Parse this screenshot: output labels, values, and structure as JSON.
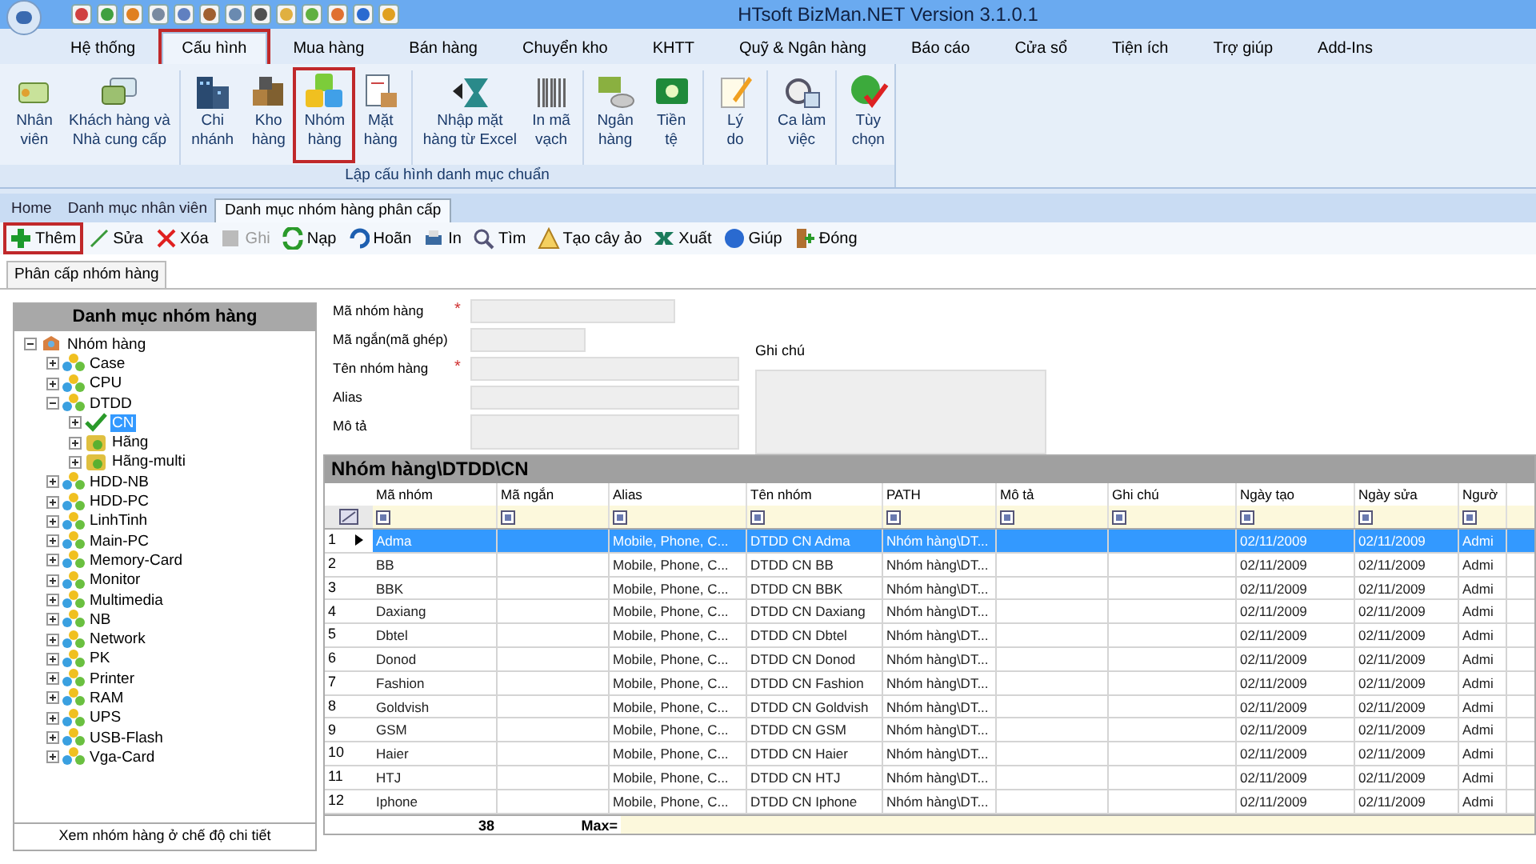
{
  "window": {
    "title": "HTsoft BizMan.NET Version 3.1.0.1"
  },
  "menu_tabs": [
    {
      "label": "Hệ thống",
      "selected": false,
      "highlighted": false
    },
    {
      "label": "Cấu hình",
      "selected": true,
      "highlighted": true
    },
    {
      "label": "Mua hàng",
      "selected": false,
      "highlighted": false
    },
    {
      "label": "Bán hàng",
      "selected": false,
      "highlighted": false
    },
    {
      "label": "Chuyển kho",
      "selected": false,
      "highlighted": false
    },
    {
      "label": "KHTT",
      "selected": false,
      "highlighted": false
    },
    {
      "label": "Quỹ & Ngân hàng",
      "selected": false,
      "highlighted": false
    },
    {
      "label": "Báo cáo",
      "selected": false,
      "highlighted": false
    },
    {
      "label": "Cửa sổ",
      "selected": false,
      "highlighted": false
    },
    {
      "label": "Tiện ích",
      "selected": false,
      "highlighted": false
    },
    {
      "label": "Trợ giúp",
      "selected": false,
      "highlighted": false
    },
    {
      "label": "Add-Ins",
      "selected": false,
      "highlighted": false
    }
  ],
  "ribbon": {
    "group_label": "Lập cấu hình danh mục chuẩn",
    "sections": [
      [
        {
          "lines": [
            "Nhân",
            "viên"
          ],
          "highlighted": false
        },
        {
          "lines": [
            "Khách hàng và",
            "Nhà cung cấp"
          ],
          "highlighted": false
        }
      ],
      [
        {
          "lines": [
            "Chi",
            "nhánh"
          ],
          "highlighted": false
        },
        {
          "lines": [
            "Kho",
            "hàng"
          ],
          "highlighted": false
        },
        {
          "lines": [
            "Nhóm",
            "hàng"
          ],
          "highlighted": true
        },
        {
          "lines": [
            "Mặt",
            "hàng"
          ],
          "highlighted": false
        }
      ],
      [
        {
          "lines": [
            "Nhập mặt",
            "hàng từ Excel"
          ],
          "highlighted": false
        },
        {
          "lines": [
            "In mã",
            "vạch"
          ],
          "highlighted": false
        }
      ],
      [
        {
          "lines": [
            "Ngân",
            "hàng"
          ],
          "highlighted": false
        },
        {
          "lines": [
            "Tiền",
            "tệ"
          ],
          "highlighted": false
        }
      ],
      [
        {
          "lines": [
            "Lý",
            "do"
          ],
          "highlighted": false
        }
      ],
      [
        {
          "lines": [
            "Ca làm",
            "việc"
          ],
          "highlighted": false
        }
      ],
      [
        {
          "lines": [
            "Tùy",
            "chọn"
          ],
          "highlighted": false
        }
      ]
    ]
  },
  "doc_tabs": [
    {
      "label": "Home",
      "selected": false
    },
    {
      "label": "Danh mục nhân viên",
      "selected": false
    },
    {
      "label": "Danh mục nhóm hàng phân cấp",
      "selected": true
    }
  ],
  "toolbar": [
    {
      "label": "Thêm",
      "disabled": false,
      "highlighted": true
    },
    {
      "label": "Sửa",
      "disabled": false,
      "highlighted": false
    },
    {
      "label": "Xóa",
      "disabled": false,
      "highlighted": false
    },
    {
      "label": "Ghi",
      "disabled": true,
      "highlighted": false
    },
    {
      "label": "Nạp",
      "disabled": false,
      "highlighted": false
    },
    {
      "label": "Hoãn",
      "disabled": false,
      "highlighted": false
    },
    {
      "label": "In",
      "disabled": false,
      "highlighted": false
    },
    {
      "label": "Tìm",
      "disabled": false,
      "highlighted": false
    },
    {
      "label": "Tạo cây ảo",
      "disabled": false,
      "highlighted": false
    },
    {
      "label": "Xuất",
      "disabled": false,
      "highlighted": false
    },
    {
      "label": "Giúp",
      "disabled": false,
      "highlighted": false
    },
    {
      "label": "Đóng",
      "disabled": false,
      "highlighted": false
    }
  ],
  "sub_tabs": [
    {
      "label": "Phân cấp nhóm hàng",
      "selected": true
    }
  ],
  "tree_panel": {
    "title": "Danh mục nhóm hàng",
    "footer": "Xem nhóm hàng ở chế độ chi tiết",
    "tree": [
      {
        "label": "Nhóm hàng",
        "kind": "root",
        "expanded": true,
        "selected": false,
        "children": [
          {
            "label": "Case",
            "kind": "group",
            "expanded": false,
            "selected": false
          },
          {
            "label": "CPU",
            "kind": "group",
            "expanded": false,
            "selected": false
          },
          {
            "label": "DTDD",
            "kind": "group",
            "expanded": true,
            "selected": false,
            "children": [
              {
                "label": "CN",
                "kind": "check",
                "expanded": false,
                "selected": true
              },
              {
                "label": "Hãng",
                "kind": "brand",
                "expanded": false,
                "selected": false
              },
              {
                "label": "Hãng-multi",
                "kind": "brand",
                "expanded": false,
                "selected": false
              }
            ]
          },
          {
            "label": "HDD-NB",
            "kind": "group",
            "expanded": false,
            "selected": false
          },
          {
            "label": "HDD-PC",
            "kind": "group",
            "expanded": false,
            "selected": false
          },
          {
            "label": "LinhTinh",
            "kind": "group",
            "expanded": false,
            "selected": false
          },
          {
            "label": "Main-PC",
            "kind": "group",
            "expanded": false,
            "selected": false
          },
          {
            "label": "Memory-Card",
            "kind": "group",
            "expanded": false,
            "selected": false
          },
          {
            "label": "Monitor",
            "kind": "group",
            "expanded": false,
            "selected": false
          },
          {
            "label": "Multimedia",
            "kind": "group",
            "expanded": false,
            "selected": false
          },
          {
            "label": "NB",
            "kind": "group",
            "expanded": false,
            "selected": false
          },
          {
            "label": "Network",
            "kind": "group",
            "expanded": false,
            "selected": false
          },
          {
            "label": "PK",
            "kind": "group",
            "expanded": false,
            "selected": false
          },
          {
            "label": "Printer",
            "kind": "group",
            "expanded": false,
            "selected": false
          },
          {
            "label": "RAM",
            "kind": "group",
            "expanded": false,
            "selected": false
          },
          {
            "label": "UPS",
            "kind": "group",
            "expanded": false,
            "selected": false
          },
          {
            "label": "USB-Flash",
            "kind": "group",
            "expanded": false,
            "selected": false
          },
          {
            "label": "Vga-Card",
            "kind": "group",
            "expanded": false,
            "selected": false
          }
        ]
      }
    ]
  },
  "form": {
    "fields": [
      {
        "label": "Mã nhóm hàng",
        "required": true
      },
      {
        "label": "Mã ngắn(mã ghép)",
        "required": false
      },
      {
        "label": "Tên nhóm hàng",
        "required": true
      },
      {
        "label": "Alias",
        "required": false
      },
      {
        "label": "Mô tả",
        "required": false
      }
    ],
    "required_mark": "*",
    "note_label": "Ghi chú"
  },
  "grid": {
    "title": "Nhóm hàng\\DTDD\\CN",
    "columns": [
      "Mã nhóm",
      "Mã ngắn",
      "Alias",
      "Tên nhóm",
      "PATH",
      "Mô tả",
      "Ghi chú",
      "Ngày tạo",
      "Ngày sửa",
      "Ngườ"
    ],
    "rows": [
      {
        "number": "1",
        "selected": true,
        "cells": [
          "Adma",
          "",
          "Mobile, Phone, C...",
          "DTDD CN Adma",
          "Nhóm hàng\\DT...",
          "",
          "",
          "02/11/2009",
          "02/11/2009",
          "Admi"
        ]
      },
      {
        "number": "2",
        "selected": false,
        "cells": [
          "BB",
          "",
          "Mobile, Phone, C...",
          "DTDD CN BB",
          "Nhóm hàng\\DT...",
          "",
          "",
          "02/11/2009",
          "02/11/2009",
          "Admi"
        ]
      },
      {
        "number": "3",
        "selected": false,
        "cells": [
          "BBK",
          "",
          "Mobile, Phone, C...",
          "DTDD CN BBK",
          "Nhóm hàng\\DT...",
          "",
          "",
          "02/11/2009",
          "02/11/2009",
          "Admi"
        ]
      },
      {
        "number": "4",
        "selected": false,
        "cells": [
          "Daxiang",
          "",
          "Mobile, Phone, C...",
          "DTDD CN Daxiang",
          "Nhóm hàng\\DT...",
          "",
          "",
          "02/11/2009",
          "02/11/2009",
          "Admi"
        ]
      },
      {
        "number": "5",
        "selected": false,
        "cells": [
          "Dbtel",
          "",
          "Mobile, Phone, C...",
          "DTDD CN Dbtel",
          "Nhóm hàng\\DT...",
          "",
          "",
          "02/11/2009",
          "02/11/2009",
          "Admi"
        ]
      },
      {
        "number": "6",
        "selected": false,
        "cells": [
          "Donod",
          "",
          "Mobile, Phone, C...",
          "DTDD CN Donod",
          "Nhóm hàng\\DT...",
          "",
          "",
          "02/11/2009",
          "02/11/2009",
          "Admi"
        ]
      },
      {
        "number": "7",
        "selected": false,
        "cells": [
          "Fashion",
          "",
          "Mobile, Phone, C...",
          "DTDD CN Fashion",
          "Nhóm hàng\\DT...",
          "",
          "",
          "02/11/2009",
          "02/11/2009",
          "Admi"
        ]
      },
      {
        "number": "8",
        "selected": false,
        "cells": [
          "Goldvish",
          "",
          "Mobile, Phone, C...",
          "DTDD CN Goldvish",
          "Nhóm hàng\\DT...",
          "",
          "",
          "02/11/2009",
          "02/11/2009",
          "Admi"
        ]
      },
      {
        "number": "9",
        "selected": false,
        "cells": [
          "GSM",
          "",
          "Mobile, Phone, C...",
          "DTDD CN GSM",
          "Nhóm hàng\\DT...",
          "",
          "",
          "02/11/2009",
          "02/11/2009",
          "Admi"
        ]
      },
      {
        "number": "10",
        "selected": false,
        "cells": [
          "Haier",
          "",
          "Mobile, Phone, C...",
          "DTDD CN Haier",
          "Nhóm hàng\\DT...",
          "",
          "",
          "02/11/2009",
          "02/11/2009",
          "Admi"
        ]
      },
      {
        "number": "11",
        "selected": false,
        "cells": [
          "HTJ",
          "",
          "Mobile, Phone, C...",
          "DTDD CN HTJ",
          "Nhóm hàng\\DT...",
          "",
          "",
          "02/11/2009",
          "02/11/2009",
          "Admi"
        ]
      },
      {
        "number": "12",
        "selected": false,
        "cells": [
          "Iphone",
          "",
          "Mobile, Phone, C...",
          "DTDD CN Iphone",
          "Nhóm hàng\\DT...",
          "",
          "",
          "02/11/2009",
          "02/11/2009",
          "Admi"
        ]
      }
    ],
    "footer": {
      "count": "38",
      "max_label": "Max="
    }
  }
}
